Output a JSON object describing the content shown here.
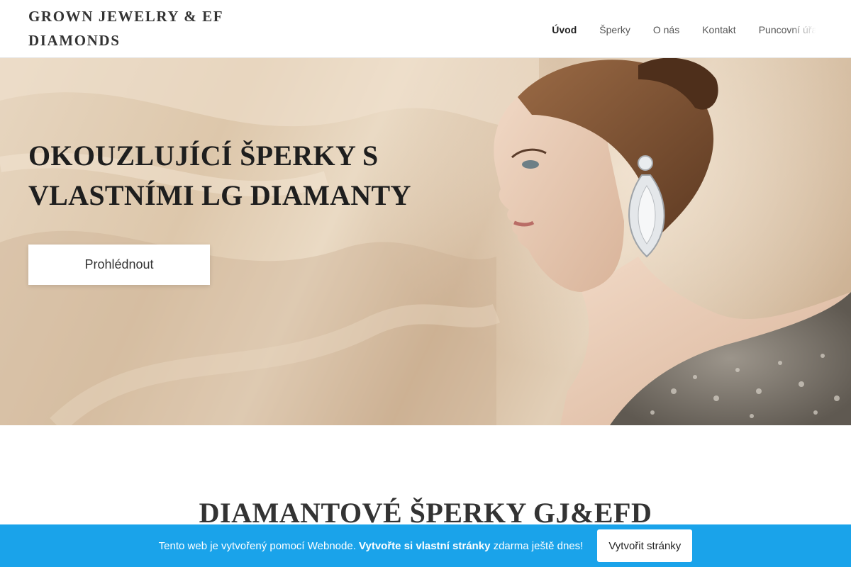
{
  "header": {
    "logo_line1": "GROWN JEWELRY & EF",
    "logo_line2": "DIAMONDS",
    "nav": [
      {
        "label": "Úvod",
        "active": true
      },
      {
        "label": "Šperky",
        "active": false
      },
      {
        "label": "O nás",
        "active": false
      },
      {
        "label": "Kontakt",
        "active": false
      },
      {
        "label": "Puncovní úřad",
        "active": false
      }
    ]
  },
  "hero": {
    "title_line1": "OKOUZLUJÍCÍ ŠPERKY S",
    "title_line2": "VLASTNÍMI LG DIAMANTY",
    "button_label": "Prohlédnout",
    "image": "woman-with-diamond-earring-photo"
  },
  "section": {
    "title": "DIAMANTOVÉ ŠPERKY GJ&EFD"
  },
  "banner": {
    "text_prefix": "Tento web je vytvořený pomocí Webnode.",
    "text_bold": "Vytvořte si vlastní stránky",
    "text_suffix": "zdarma ještě dnes!",
    "button_label": "Vytvořit stránky"
  },
  "colors": {
    "banner_bg": "#1aa3ea",
    "text_dark": "#222222"
  }
}
